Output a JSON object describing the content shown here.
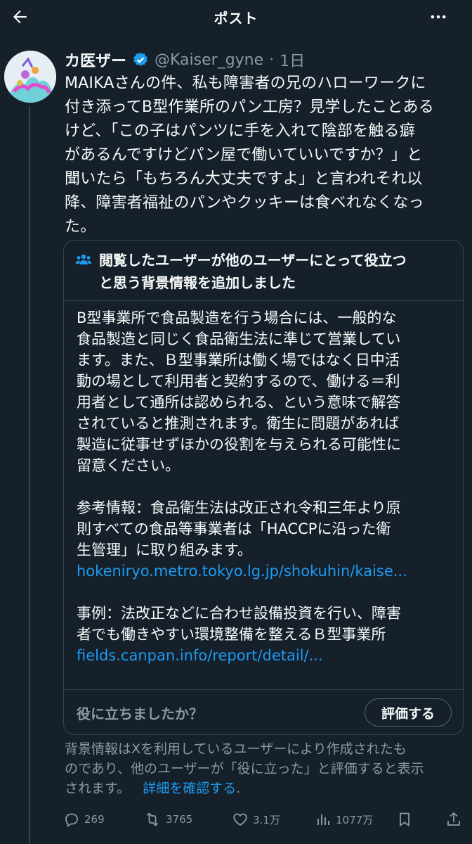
{
  "header": {
    "title": "ポスト",
    "back_icon": "arrow-left-icon",
    "more_icon": "more-horizontal-icon"
  },
  "post": {
    "author_name": "カ医ザー",
    "handle": "@Kaiser_gyne",
    "separator": "·",
    "time": "1日",
    "verified_icon": "verified-badge-icon",
    "verified_color": "#1d9bf0",
    "text_lines": [
      "MAIKAさんの件、私も障害者の兄のハローワークに",
      "付き添ってB型作業所のパン工房？見学したことある",
      "けど、「この子はパンツに手を入れて陰部を触る癖",
      "があるんですけどパン屋で働いていいですか？」と",
      "聞いたら「もちろん大丈夫ですよ」と言われそれ以",
      "降、障害者福祉のパンやクッキーは食べれなくなっ",
      "た。"
    ]
  },
  "community_note": {
    "icon": "people-icon",
    "title_lines": [
      "閲覧したユーザーが他のユーザーにとって役立つ",
      "と思う背景情報を追加しました"
    ],
    "body_paragraph1": [
      "B型事業所で食品製造を行う場合には、一般的な",
      "食品製造と同じく食品衛生法に準じて営業してい",
      "ます。また、Ｂ型事業所は働く場ではなく日中活",
      "動の場として利用者と契約するので、働ける＝利",
      "用者として通所は認められる、という意味で解答",
      "されていると推測されます。衛生に問題があれば",
      "製造に従事せずほかの役割を与えられる可能性に",
      "留意ください。"
    ],
    "body_paragraph2": [
      "参考情報：食品衛生法は改正され令和三年より原",
      "則すべての食品等事業者は「HACCPに沿った衛",
      "生管理」に取り組みます。"
    ],
    "link1": "hokeniryo.metro.tokyo.lg.jp/shokuhin/kaise...",
    "body_paragraph3": [
      "事例：法改正などに合わせ設備投資を行い、障害",
      "者でも働きやすい環境整備を整えるＢ型事業所"
    ],
    "link2": "fields.canpan.info/report/detail/...",
    "helpful_question": "役に立ちましたか？",
    "rate_button": "評価する",
    "link_color": "#1d9bf0"
  },
  "disclaimer": {
    "lines": [
      "背景情報はXを利用しているユーザーにより作成されたも",
      "のであり、他のユーザーが「役に立った」と評価すると表示"
    ],
    "last_line_text": "されます。",
    "learn_more_link": "詳細を確認する",
    "end_period": "."
  },
  "actions": {
    "reply": {
      "icon": "reply-icon",
      "count": "269"
    },
    "repost": {
      "icon": "repost-icon",
      "count": "3765"
    },
    "like": {
      "icon": "heart-icon",
      "count": "3.1万"
    },
    "views": {
      "icon": "views-chart-icon",
      "count": "1077万"
    },
    "bookmark": {
      "icon": "bookmark-icon"
    },
    "share": {
      "icon": "share-icon"
    }
  },
  "colors": {
    "background": "#15202b",
    "text": "#f7f9f9",
    "muted": "#8b98a5",
    "border": "#38444d",
    "accent": "#1d9bf0"
  }
}
